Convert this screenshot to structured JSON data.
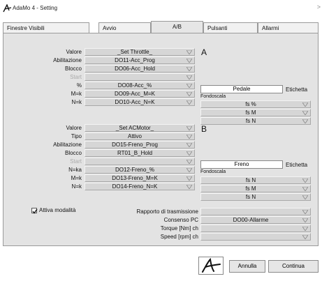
{
  "window": {
    "title": "AdaMo 4 - Setting",
    "chevron": ">"
  },
  "tabs": [
    "Finestre Visibili",
    "Avvio",
    "A/B",
    "Pulsanti",
    "Allarmi"
  ],
  "section_a": {
    "letter": "A",
    "rows": [
      {
        "label": "Valore",
        "value": "_Set Throttle_",
        "disabled": false
      },
      {
        "label": "Abilitazione",
        "value": "DO11-Acc_Prog",
        "disabled": false
      },
      {
        "label": "Blocco",
        "value": "DO06-Acc_Hold",
        "disabled": false
      },
      {
        "label": "Start",
        "value": "",
        "disabled": true
      },
      {
        "label": "%",
        "value": "DO08-Acc_%",
        "disabled": false
      },
      {
        "label": "M=k",
        "value": "DO09-Acc_M=K",
        "disabled": false
      },
      {
        "label": "N=k",
        "value": "DO10-Acc_N=K",
        "disabled": false
      }
    ],
    "text_field": "Pedale",
    "text_field_label": "Etichetta",
    "fondoscala_label": "Fondoscala",
    "fondoscala": [
      "fs %",
      "fs M",
      "fs N"
    ]
  },
  "section_b": {
    "letter": "B",
    "rows": [
      {
        "label": "Valore",
        "value": "_Set ACMotor_",
        "disabled": false
      },
      {
        "label": "Tipo",
        "value": "Attivo",
        "disabled": false
      },
      {
        "label": "Abilitazione",
        "value": "DO15-Freno_Prog",
        "disabled": false
      },
      {
        "label": "Blocco",
        "value": "RT01_B_Hold",
        "disabled": false
      },
      {
        "label": "Start",
        "value": "",
        "disabled": true
      },
      {
        "label": "N=ka",
        "value": "DO12-Freno_%",
        "disabled": false
      },
      {
        "label": "M=k",
        "value": "DO13-Freno_M=K",
        "disabled": false
      },
      {
        "label": "N=k",
        "value": "DO14-Freno_N=K",
        "disabled": false
      }
    ],
    "text_field": "Freno",
    "text_field_label": "Etichetta",
    "fondoscala_label": "Fondoscala",
    "fondoscala": [
      "fs N",
      "fs M",
      "fs N"
    ]
  },
  "mode": {
    "label": "Attiva modalità",
    "checked": true
  },
  "transmission": [
    {
      "label": "Rapporto di trasmissione",
      "value": ""
    },
    {
      "label": "Consenso PC",
      "value": "DO00-Allarme"
    },
    {
      "label": "Torque [Nm] ch",
      "value": ""
    },
    {
      "label": "Speed [rpm] ch",
      "value": ""
    }
  ],
  "buttons": {
    "cancel": "Annulla",
    "continue": "Continua"
  }
}
